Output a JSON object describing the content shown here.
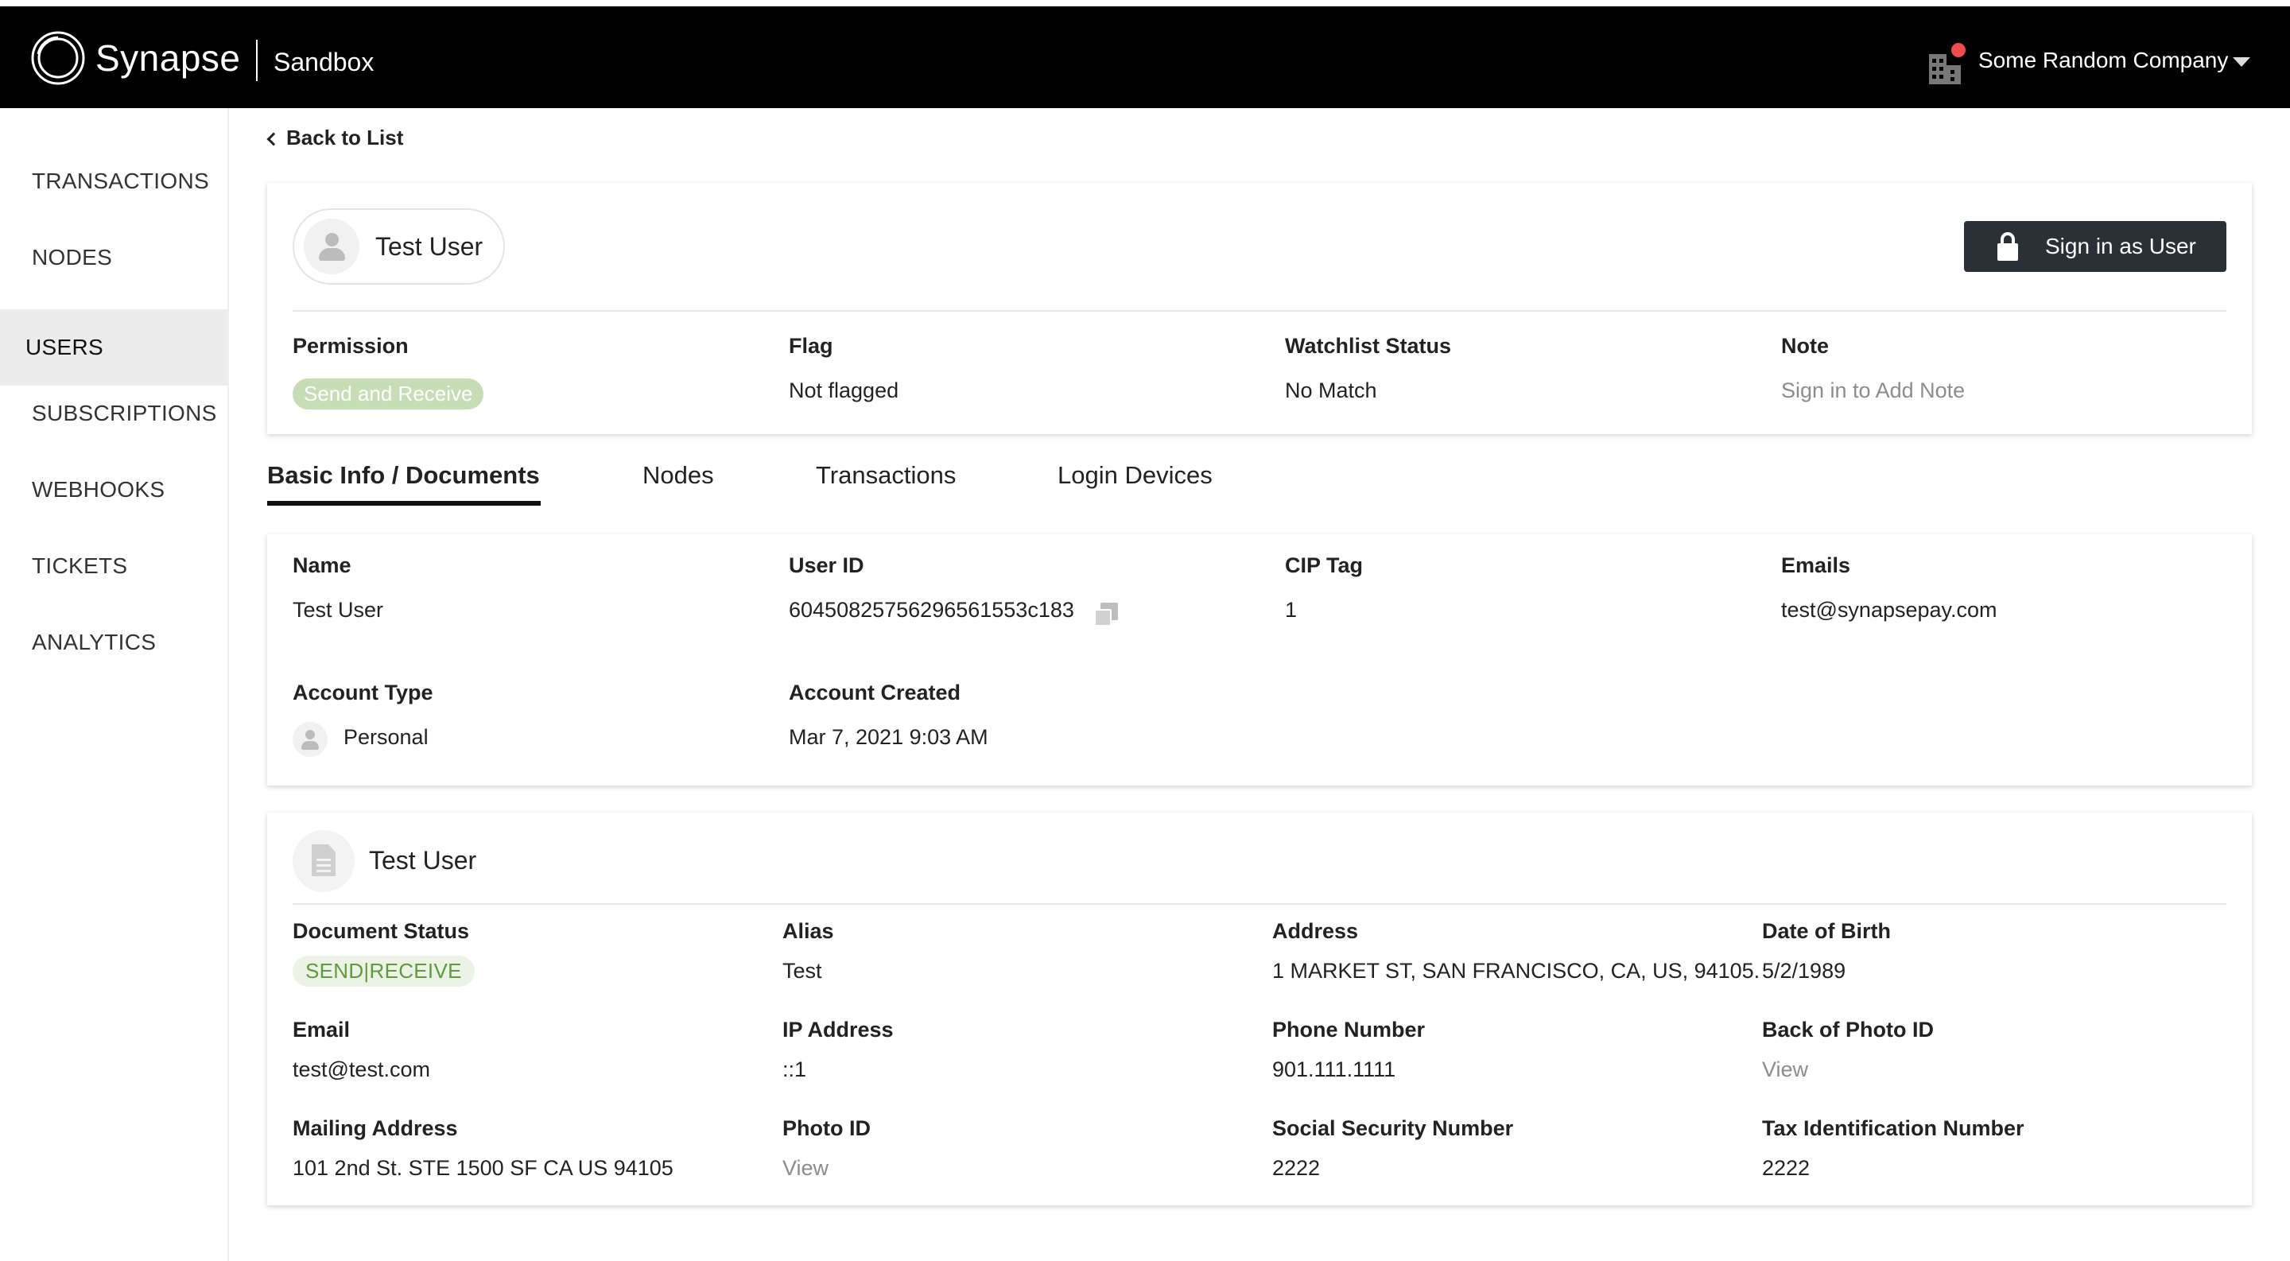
{
  "header": {
    "brand": "Synapse",
    "environment": "Sandbox",
    "company": "Some Random Company",
    "notification_color": "#ee4d4d"
  },
  "sidebar": {
    "items": [
      {
        "label": "TRANSACTIONS",
        "active": false
      },
      {
        "label": "NODES",
        "active": false
      },
      {
        "label": "USERS",
        "active": true
      },
      {
        "label": "SUBSCRIPTIONS",
        "active": false
      },
      {
        "label": "WEBHOOKS",
        "active": false
      },
      {
        "label": "TICKETS",
        "active": false
      },
      {
        "label": "ANALYTICS",
        "active": false
      }
    ]
  },
  "back_link": "Back to List",
  "user_card": {
    "name": "Test User",
    "sign_in_button": "Sign in as User",
    "fields": {
      "permission": {
        "label": "Permission",
        "value": "Send and Receive"
      },
      "flag": {
        "label": "Flag",
        "value": "Not flagged"
      },
      "watchlist": {
        "label": "Watchlist Status",
        "value": "No Match"
      },
      "note": {
        "label": "Note",
        "value": "Sign in to Add Note"
      }
    }
  },
  "tabs": [
    {
      "label": "Basic Info / Documents",
      "active": true
    },
    {
      "label": "Nodes",
      "active": false
    },
    {
      "label": "Transactions",
      "active": false
    },
    {
      "label": "Login Devices",
      "active": false
    }
  ],
  "basic_info": {
    "name": {
      "label": "Name",
      "value": "Test User"
    },
    "user_id": {
      "label": "User ID",
      "value": "6045082575629656155​3c183"
    },
    "cip_tag": {
      "label": "CIP Tag",
      "value": "1"
    },
    "emails": {
      "label": "Emails",
      "value": "test@synapsepay.com"
    },
    "account_type": {
      "label": "Account Type",
      "value": "Personal"
    },
    "account_created": {
      "label": "Account Created",
      "value": "Mar 7, 2021 9:03 AM"
    }
  },
  "document": {
    "title": "Test User",
    "document_status": {
      "label": "Document Status",
      "value": "SEND|RECEIVE"
    },
    "alias": {
      "label": "Alias",
      "value": "Test"
    },
    "address": {
      "label": "Address",
      "value": "1 MARKET ST, SAN FRANCISCO, CA, US, 94105."
    },
    "dob": {
      "label": "Date of Birth",
      "value": "5/2/1989"
    },
    "email": {
      "label": "Email",
      "value": "test@test.com"
    },
    "ip": {
      "label": "IP Address",
      "value": "::1"
    },
    "phone": {
      "label": "Phone Number",
      "value": "901.111.1111"
    },
    "back_photo_id": {
      "label": "Back of Photo ID",
      "value": "View"
    },
    "mailing_address": {
      "label": "Mailing Address",
      "value": "101 2nd St. STE 1500 SF CA US 94105"
    },
    "photo_id": {
      "label": "Photo ID",
      "value": "View"
    },
    "ssn": {
      "label": "Social Security Number",
      "value": "2222"
    },
    "tin": {
      "label": "Tax Identification Number",
      "value": "2222"
    }
  }
}
